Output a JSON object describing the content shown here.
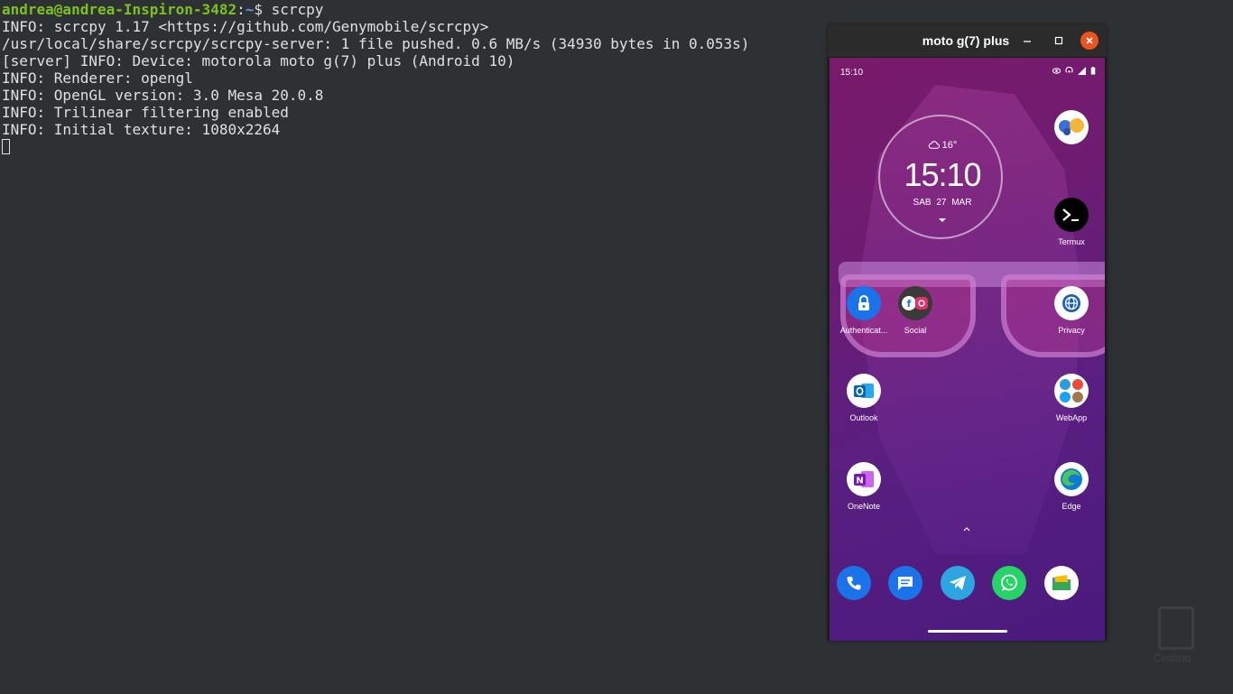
{
  "terminal": {
    "prompt_user": "andrea@andrea-Inspiron-3482",
    "prompt_sep": ":",
    "prompt_path": "~",
    "prompt_symbol": "$ ",
    "command": "scrcpy",
    "lines": [
      "INFO: scrcpy 1.17 <https://github.com/Genymobile/scrcpy>",
      "/usr/local/share/scrcpy/scrcpy-server: 1 file pushed. 0.6 MB/s (34930 bytes in 0.053s)",
      "[server] INFO: Device: motorola moto g(7) plus (Android 10)",
      "INFO: Renderer: opengl",
      "INFO: OpenGL version: 3.0 Mesa 20.0.8",
      "INFO: Trilinear filtering enabled",
      "INFO: Initial texture: 1080x2264"
    ]
  },
  "desktop": {
    "watermark_label": "Cestino"
  },
  "window": {
    "title": "moto g(7) plus",
    "close_color": "#e95420"
  },
  "phone": {
    "status_time": "15:10",
    "clock": {
      "weather": "16°",
      "time": "15:10",
      "date": "SAB  27  MAR"
    },
    "apps": {
      "folder_top": "",
      "termux": "Termux",
      "authenticator": "Authenticat...",
      "social": "Social",
      "privacy": "Privacy",
      "outlook": "Outlook",
      "webapp": "WebApp",
      "onenote": "OneNote",
      "edge": "Edge"
    },
    "dock": [
      "phone-icon",
      "messages-icon",
      "telegram-icon",
      "whatsapp-icon",
      "files-icon"
    ]
  }
}
